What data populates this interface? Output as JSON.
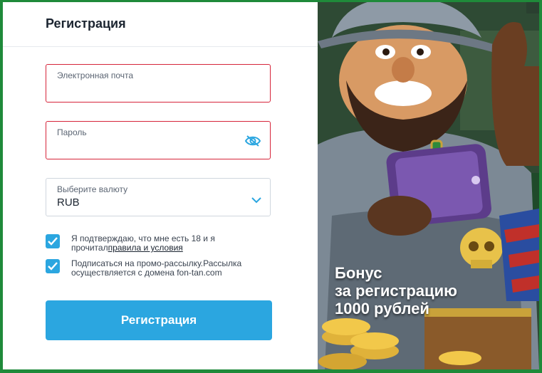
{
  "modal": {
    "title": "Регистрация",
    "email": {
      "label": "Электронная почта",
      "value": ""
    },
    "password": {
      "label": "Пароль",
      "value": ""
    },
    "currency": {
      "label": "Выберите валюту",
      "value": "RUB"
    },
    "consent": {
      "text": "Я подтверждаю, что мне есть 18 и я прочитал",
      "link": "правила и условия",
      "checked": true
    },
    "newsletter": {
      "text": "Подписаться на промо-рассылку.Рассылка осуществляется с домена fon-tan.com",
      "checked": true
    },
    "submit_label": "Регистрация"
  },
  "promo": {
    "line1": "Бонус",
    "line2": "за регистрацию",
    "line3": "1000 рублей"
  },
  "colors": {
    "accent": "#2ba6e0",
    "error": "#d6243a",
    "frame": "#1f8a3a"
  },
  "icons": {
    "password_toggle": "eye-slash-icon",
    "currency_dropdown": "chevron-down-icon",
    "checkbox": "checkmark-icon"
  }
}
